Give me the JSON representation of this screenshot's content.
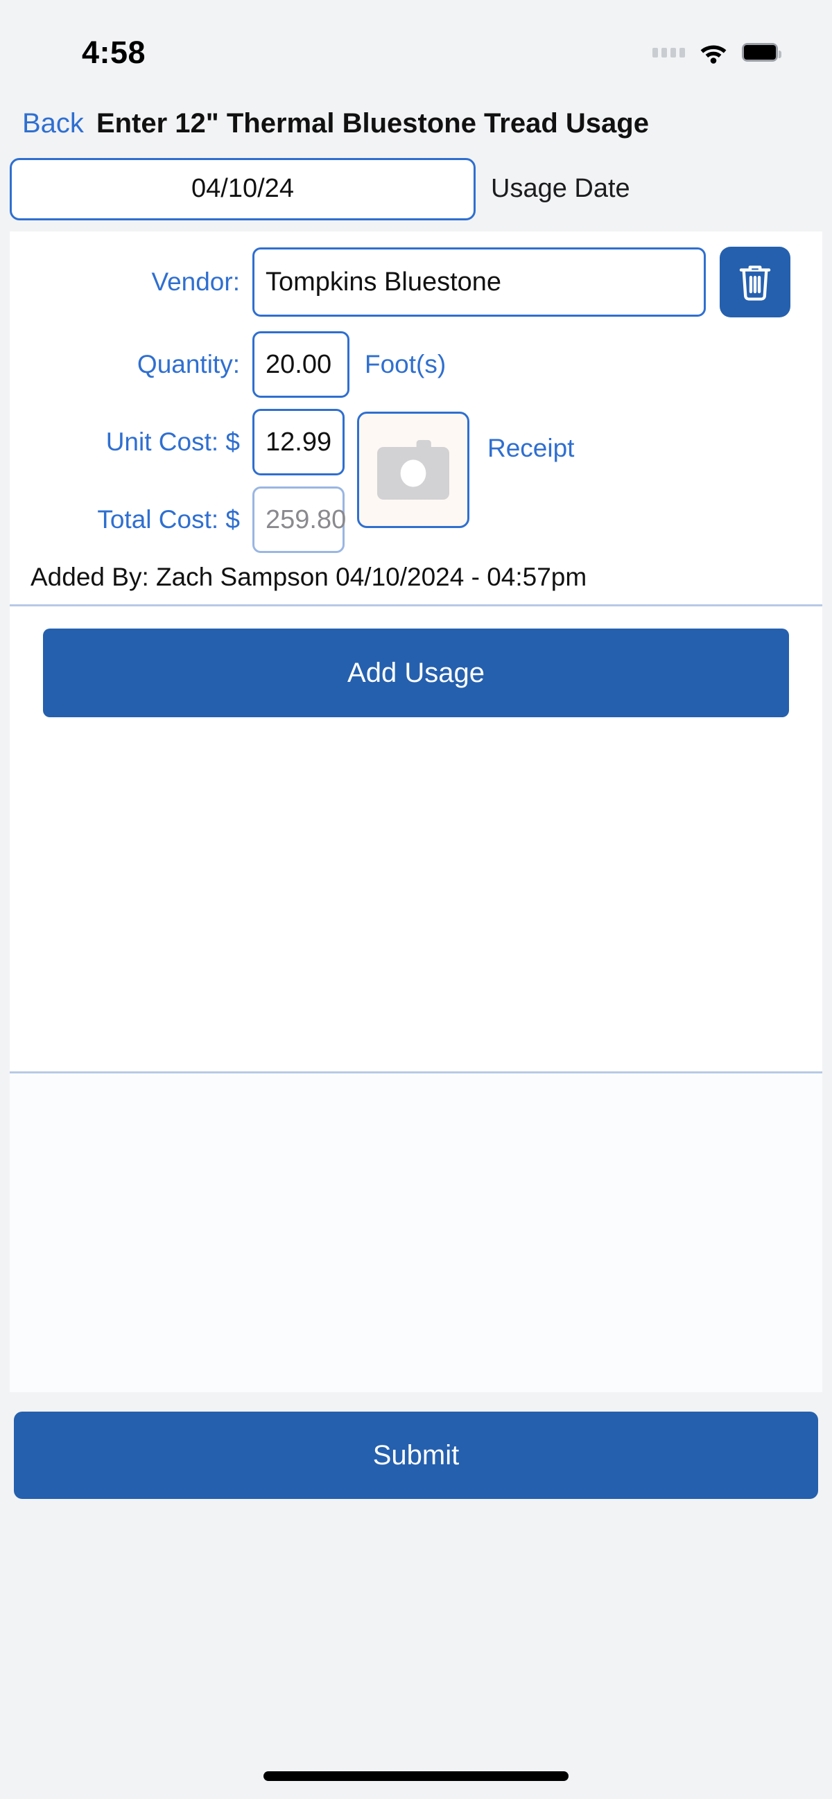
{
  "status_bar": {
    "time": "4:58",
    "signal_icon": "signal-dots-icon",
    "wifi_icon": "wifi-icon",
    "battery_icon": "battery-full-icon"
  },
  "nav": {
    "back_label": "Back",
    "title": "Enter 12\" Thermal Bluestone Tread Usage"
  },
  "usage_date": {
    "value": "04/10/24",
    "label": "Usage Date"
  },
  "entry": {
    "vendor": {
      "label": "Vendor:",
      "value": "Tompkins Bluestone",
      "delete_icon": "trash-icon"
    },
    "quantity": {
      "label": "Quantity:",
      "value": "20.00",
      "unit": "Foot(s)"
    },
    "unit_cost": {
      "label": "Unit Cost: $",
      "value": "12.99"
    },
    "total_cost": {
      "label": "Total Cost: $",
      "value": "259.80"
    },
    "receipt": {
      "label": "Receipt",
      "icon": "camera-icon"
    },
    "added_by": "Added By: Zach Sampson 04/10/2024 - 04:57pm"
  },
  "actions": {
    "add_usage_label": "Add Usage",
    "submit_label": "Submit"
  },
  "colors": {
    "accent_blue": "#2560ae",
    "link_blue": "#2f6fd0",
    "page_bg": "#f2f3f5",
    "card_bg": "#ffffff",
    "receipt_bg": "#fdf8f4",
    "readonly_text": "#8a8a8e"
  }
}
